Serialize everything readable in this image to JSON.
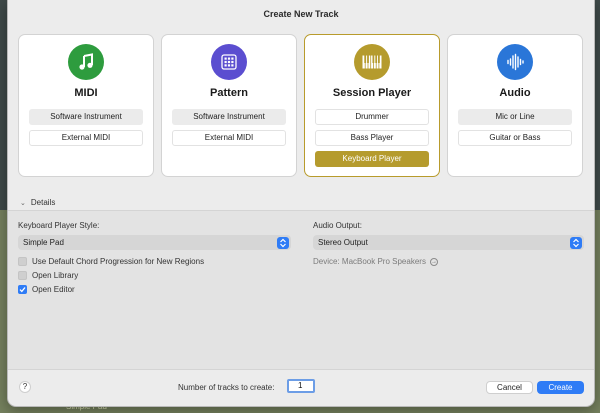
{
  "dialog": {
    "title": "Create New Track"
  },
  "cards": [
    {
      "title": "MIDI",
      "icon": "music-note-icon",
      "color": "#2e9c3e",
      "options": [
        "Software Instrument",
        "External MIDI"
      ]
    },
    {
      "title": "Pattern",
      "icon": "pattern-grid-icon",
      "color": "#5b4ed0",
      "options": [
        "Software Instrument",
        "External MIDI"
      ]
    },
    {
      "title": "Session Player",
      "icon": "piano-keys-icon",
      "color": "#b59b2d",
      "options": [
        "Drummer",
        "Bass Player",
        "Keyboard Player"
      ],
      "selected": "Keyboard Player"
    },
    {
      "title": "Audio",
      "icon": "waveform-icon",
      "color": "#2a76d8",
      "options": [
        "Mic or Line",
        "Guitar or Bass"
      ]
    }
  ],
  "details": {
    "toggle_label": "Details",
    "style_label": "Keyboard Player Style:",
    "style_value": "Simple Pad",
    "output_label": "Audio Output:",
    "output_value": "Stereo Output",
    "device_text": "Device: MacBook Pro Speakers",
    "checkboxes": [
      {
        "label": "Use Default Chord Progression for New Regions",
        "checked": false
      },
      {
        "label": "Open Library",
        "checked": false
      },
      {
        "label": "Open Editor",
        "checked": true
      }
    ]
  },
  "footer": {
    "help_label": "?",
    "count_label": "Number of tracks to create:",
    "count_value": "1",
    "cancel_label": "Cancel",
    "create_label": "Create"
  },
  "background": {
    "track_text": "Simple Pad"
  },
  "colors": {
    "accent": "#2f7cf6",
    "selected_gold": "#b59b2d"
  }
}
